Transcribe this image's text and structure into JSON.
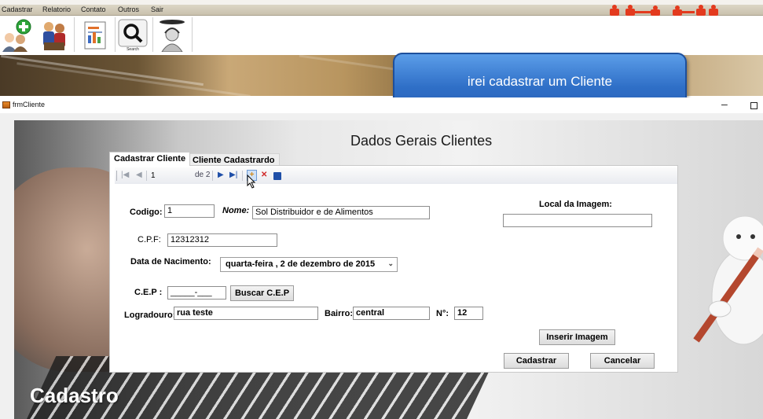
{
  "menu": [
    "Cadastrar",
    "Relatorio",
    "Contato",
    "Outros",
    "Sair"
  ],
  "toolbar": {
    "buttons": [
      {
        "icon": "add-client-icon"
      },
      {
        "icon": "users-icon"
      },
      {
        "icon": "report-icon"
      },
      {
        "icon": "search-icon",
        "label": "Search"
      },
      {
        "icon": "support-icon"
      }
    ]
  },
  "callout": "irei cadastrar um Cliente",
  "window": {
    "title": "frmCliente",
    "minimize": "–"
  },
  "form": {
    "heading": "Dados Gerais Clientes",
    "tabs": [
      "Cadastrar Cliente",
      "Cliente Cadastrardo"
    ],
    "navigator": {
      "position": "1",
      "of_total": "de 2",
      "icons": [
        "move-first-icon",
        "move-previous-icon",
        "move-next-icon",
        "move-last-icon",
        "add-new-icon",
        "delete-icon",
        "save-icon"
      ]
    },
    "codigo": {
      "label": "Codigo:",
      "value": "1"
    },
    "nome": {
      "label": "Nome:",
      "value": "Sol Distribuidor e de Alimentos"
    },
    "cpf": {
      "label": "C.P.F:",
      "value": "12312312"
    },
    "nascimento": {
      "label": "Data de Nacimento:",
      "value": "quarta-feira ,   2 de dezembro de 2015"
    },
    "cep": {
      "label": "C.E.P :",
      "value": "_____-___"
    },
    "buscar_cep": "Buscar C.E.P",
    "logradouro": {
      "label": "Logradouro:",
      "value": "rua teste"
    },
    "bairro": {
      "label": "Bairro:",
      "value": "central"
    },
    "numero": {
      "label": "N°:",
      "value": "12"
    },
    "imagem": {
      "label": "Local  da Imagem:",
      "value": ""
    },
    "inserir_imagem": "Inserir Imagem",
    "cadastrar": "Cadastrar",
    "cancelar": "Cancelar"
  },
  "background_caption": "Cadastro",
  "colors": {
    "callout": "#2f6fc7",
    "menubar": "#d2cab7",
    "panel": "#ffffff"
  }
}
